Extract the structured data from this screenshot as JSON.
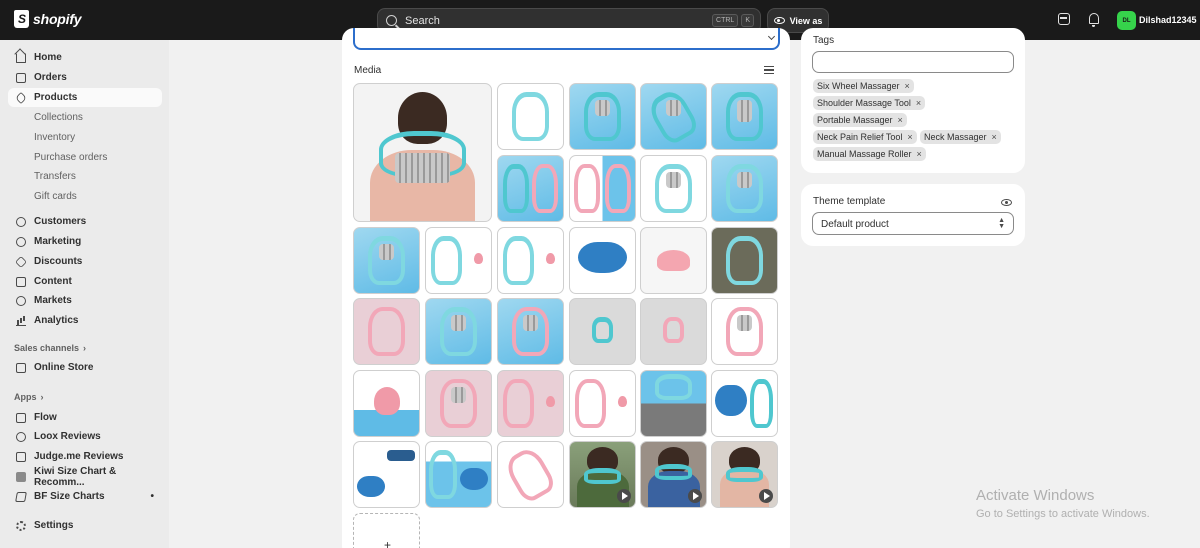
{
  "topbar": {
    "logo_text": "shopify",
    "search_placeholder": "Search",
    "search_shortcut": [
      "CTRL",
      "K"
    ],
    "view_as_label": "View as",
    "avatar_initials": "DL",
    "username": "Dilshad12345"
  },
  "sidebar": {
    "items": [
      {
        "label": "Home",
        "icon": "home-icon"
      },
      {
        "label": "Orders",
        "icon": "orders-icon"
      },
      {
        "label": "Products",
        "icon": "tag-icon",
        "active": true
      },
      {
        "label": "Customers",
        "icon": "person-icon"
      },
      {
        "label": "Marketing",
        "icon": "target-icon"
      },
      {
        "label": "Discounts",
        "icon": "discount-icon"
      },
      {
        "label": "Content",
        "icon": "content-icon"
      },
      {
        "label": "Markets",
        "icon": "globe-icon"
      },
      {
        "label": "Analytics",
        "icon": "analytics-icon"
      }
    ],
    "product_subitems": [
      "Collections",
      "Inventory",
      "Purchase orders",
      "Transfers",
      "Gift cards"
    ],
    "sales_channels_label": "Sales channels",
    "online_store_label": "Online Store",
    "apps_label": "Apps",
    "apps": [
      "Flow",
      "Loox Reviews",
      "Judge.me Reviews",
      "Kiwi Size Chart & Recomm...",
      "BF Size Charts"
    ],
    "settings_label": "Settings"
  },
  "media": {
    "label": "Media",
    "add_symbol": "+"
  },
  "tags": {
    "label": "Tags",
    "values": [
      "Six Wheel Massager",
      "Shoulder Massage Tool",
      "Portable Massager",
      "Neck Pain Relief Tool",
      "Neck Massager",
      "Manual Massage Roller"
    ],
    "remove_symbol": "×"
  },
  "theme_template": {
    "label": "Theme template",
    "selected": "Default product"
  },
  "watermark": {
    "title": "Activate Windows",
    "subtitle": "Go to Settings to activate Windows."
  },
  "colors": {
    "topbar": "#1a1a1a",
    "sidebar": "#ebebeb",
    "focus_ring": "#2c6ecb",
    "avatar": "#36d34b"
  }
}
